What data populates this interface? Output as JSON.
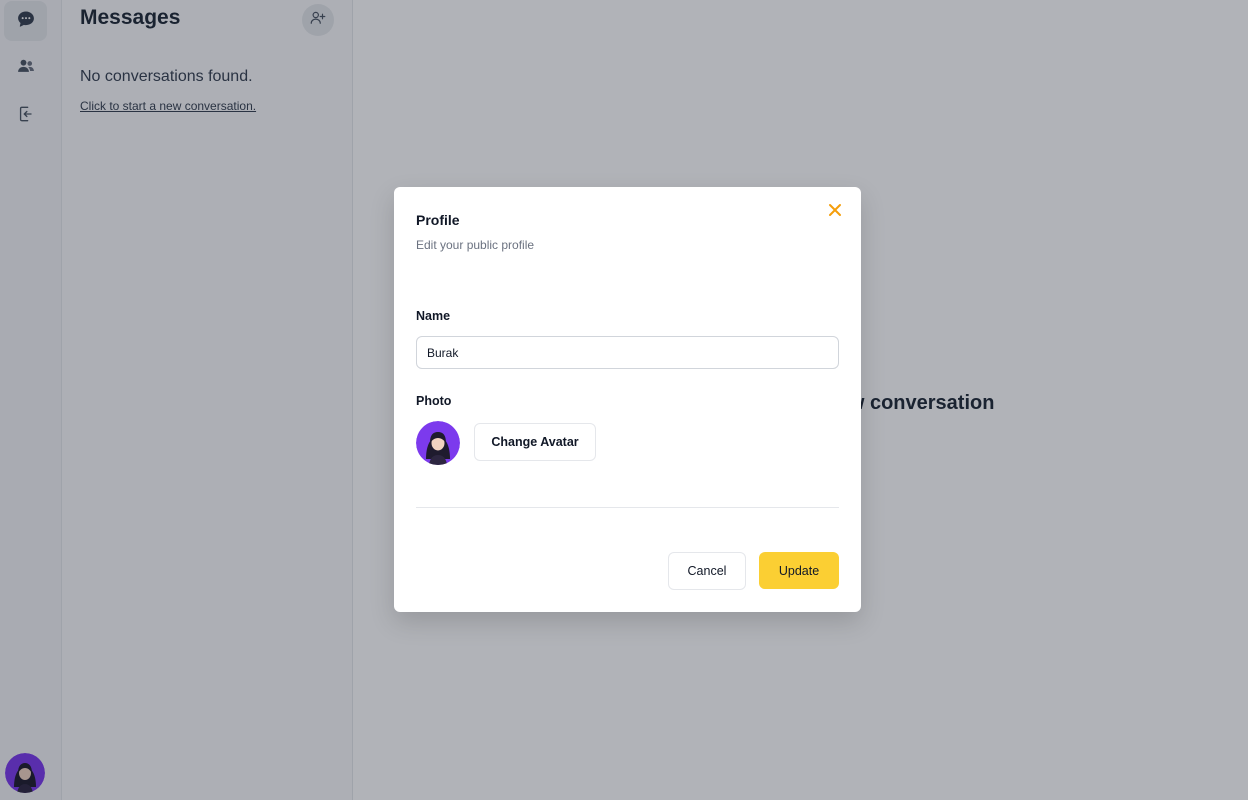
{
  "sidebar": {
    "items": [
      {
        "icon": "chat-bubble-icon",
        "active": true
      },
      {
        "icon": "users-icon",
        "active": false
      },
      {
        "icon": "logout-icon",
        "active": false
      }
    ],
    "avatar_icon": "user-avatar"
  },
  "conversations": {
    "title": "Messages",
    "add_icon": "add-user-icon",
    "empty_text": "No conversations found.",
    "start_link": "Click to start a new conversation."
  },
  "main": {
    "placeholder": "Select a chat or start a new conversation"
  },
  "modal": {
    "title": "Profile",
    "subtitle": "Edit your public profile",
    "name_label": "Name",
    "name_value": "Burak",
    "photo_label": "Photo",
    "change_avatar_label": "Change Avatar",
    "cancel_label": "Cancel",
    "update_label": "Update",
    "close_icon": "close-icon"
  },
  "colors": {
    "accent": "#fbcf33",
    "close": "#f59e0b",
    "avatar_bg": "#7c3aed"
  }
}
